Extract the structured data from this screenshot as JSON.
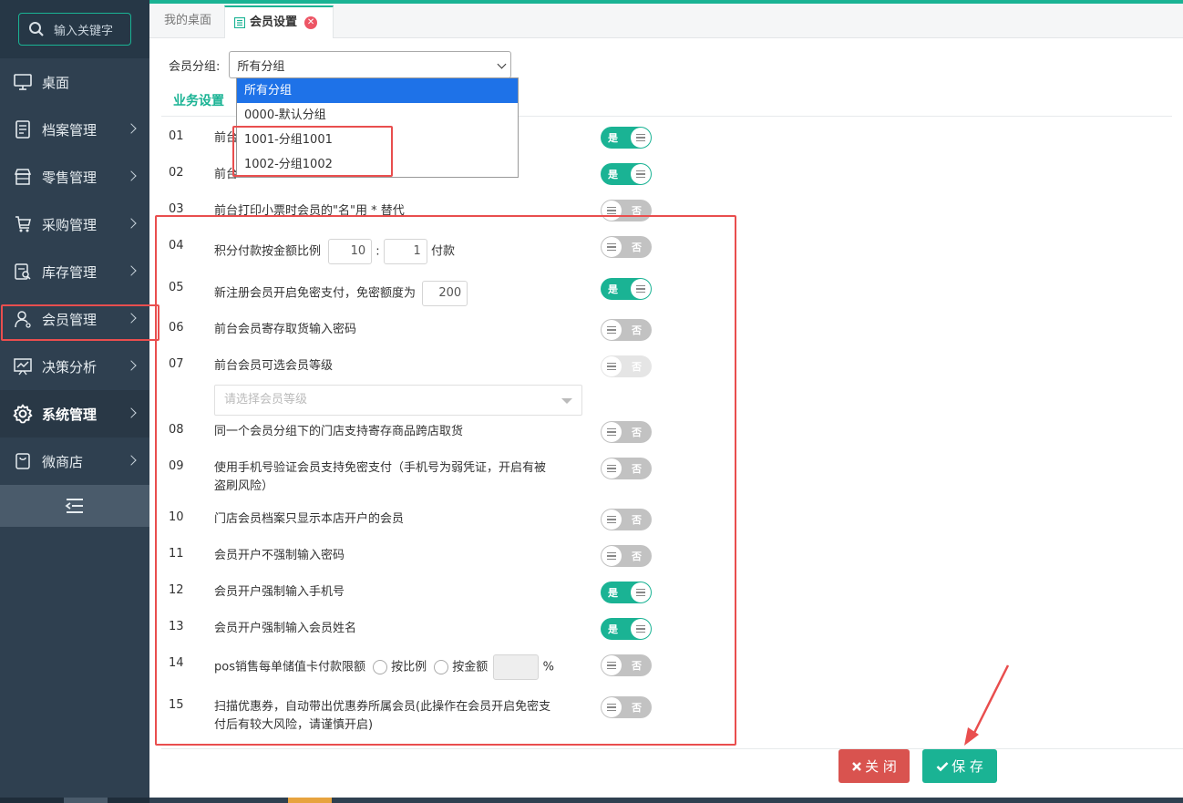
{
  "sidebar": {
    "search_placeholder": "输入关键字",
    "items": [
      {
        "label": "桌面"
      },
      {
        "label": "档案管理"
      },
      {
        "label": "零售管理"
      },
      {
        "label": "采购管理"
      },
      {
        "label": "库存管理"
      },
      {
        "label": "会员管理"
      },
      {
        "label": "决策分析"
      },
      {
        "label": "系统管理"
      },
      {
        "label": "微商店"
      }
    ]
  },
  "tabs": {
    "home": "我的桌面",
    "active": "会员设置"
  },
  "group": {
    "label": "会员分组:",
    "selected": "所有分组",
    "options": [
      "所有分组",
      "0000-默认分组",
      "1001-分组1001",
      "1002-分组1002"
    ]
  },
  "section_title": "业务设置",
  "settings": [
    {
      "num": "01",
      "label": "前台",
      "state": "是"
    },
    {
      "num": "02",
      "label": "前台",
      "state": "是"
    },
    {
      "num": "03",
      "label": "前台打印小票时会员的\"名\"用 * 替代",
      "state": "否"
    },
    {
      "num": "04",
      "label": "积分付款按金额比例",
      "ratio_a": "10",
      "ratio_sep": ":",
      "ratio_b": "1",
      "suffix": "付款",
      "state": "否"
    },
    {
      "num": "05",
      "label": "新注册会员开启免密支付，免密额度为",
      "amount": "200",
      "state": "是"
    },
    {
      "num": "06",
      "label": "前台会员寄存取货输入密码",
      "state": "否"
    },
    {
      "num": "07",
      "label": "前台会员可选会员等级",
      "placeholder": "请选择会员等级",
      "state": "否"
    },
    {
      "num": "08",
      "label": "同一个会员分组下的门店支持寄存商品跨店取货",
      "state": "否"
    },
    {
      "num": "09",
      "label_line1": "使用手机号验证会员支持免密支付（手机号为弱凭证，开启有被",
      "label_line2": "盗刷风险）",
      "state": "否"
    },
    {
      "num": "10",
      "label": "门店会员档案只显示本店开户的会员",
      "state": "否"
    },
    {
      "num": "11",
      "label": "会员开户不强制输入密码",
      "state": "否"
    },
    {
      "num": "12",
      "label": "会员开户强制输入手机号",
      "state": "是"
    },
    {
      "num": "13",
      "label": "会员开户强制输入会员姓名",
      "state": "是"
    },
    {
      "num": "14",
      "label": "pos销售每单储值卡付款限额",
      "opt1": "按比例",
      "opt2": "按金额",
      "unit": "%",
      "state": "否"
    },
    {
      "num": "15",
      "label_line1": "扫描优惠券，自动带出优惠券所属会员(此操作在会员开启免密支",
      "label_line2": "付后有较大风险，请谨慎开启)",
      "state": "否"
    }
  ],
  "buttons": {
    "close": "关 闭",
    "save": "保 存"
  },
  "colors": {
    "accent": "#1ab394",
    "danger": "#d9534f",
    "sidebar": "#2f4050",
    "highlight": "#e94e4e"
  }
}
